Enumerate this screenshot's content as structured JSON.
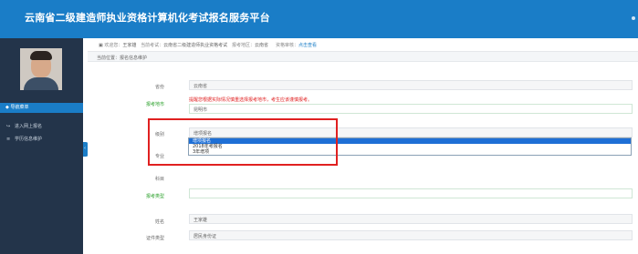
{
  "header": {
    "title": "云南省二级建造师执业资格计算机化考试报名服务平台"
  },
  "sidebar": {
    "nav_head": "导航菜单",
    "items": [
      {
        "label": "进入网上报名",
        "icon": "↪"
      },
      {
        "label": "学历信息维护",
        "icon": "≡"
      }
    ]
  },
  "infobar": {
    "welcome_label": "欢迎您：",
    "user": "王家雄",
    "exam_label": "当前考试：",
    "exam": "云南省二级建造师执业资格考试",
    "region_label": "报考地区：",
    "region": "云南省",
    "status_label": "资格审核：",
    "status_link": "点击查看"
  },
  "breadcrumb": "当前位置：报名信息维护",
  "form": {
    "province_label": "省份",
    "province_value": "云南省",
    "city_label": "报考地市",
    "warning": "提醒您根据实际情况慎重选择报考地市，考生应该谨慎报考。",
    "city_value": "昆明市",
    "level_label": "级别",
    "level_value": "增项报名",
    "major_label": "专业",
    "subject_label": "科目",
    "type_label": "报考类型",
    "name_label": "姓名",
    "name_value": "王家雄",
    "idtype_label": "证件类型",
    "idtype_value": "居民身份证"
  },
  "dropdown": {
    "options": [
      "增项报名",
      "2018年考报名",
      "3年增项"
    ],
    "selected_index": 0
  },
  "colors": {
    "brand": "#1a7dc7",
    "sidebar": "#23344a",
    "highlight": "#e02020",
    "selected": "#1e6fd6"
  }
}
